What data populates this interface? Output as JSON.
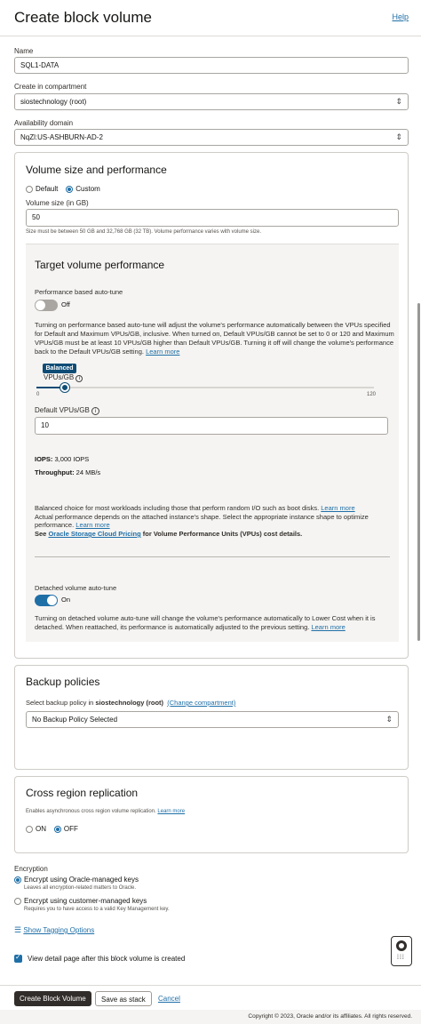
{
  "header": {
    "title": "Create block volume",
    "help": "Help"
  },
  "form": {
    "name_label": "Name",
    "name_value": "SQL1-DATA",
    "compartment_label": "Create in compartment",
    "compartment_value": "siostechnology (root)",
    "ad_label": "Availability domain",
    "ad_value": "NqZl:US-ASHBURN-AD-2"
  },
  "volume": {
    "title": "Volume size and performance",
    "default_label": "Default",
    "custom_label": "Custom",
    "size_label": "Volume size (in GB)",
    "size_value": "50",
    "size_help": "Size must be between 50 GB and 32,768 GB (32 TB). Volume performance varies with volume size."
  },
  "target": {
    "title": "Target volume performance",
    "autotune_label": "Performance based auto-tune",
    "autotune_state": "Off",
    "autotune_desc": "Turning on performance based auto-tune will adjust the volume's performance automatically between the VPUs specified for Default and Maximum VPUs/GB, inclusive. When turned on, Default VPUs/GB cannot be set to 0 or 120 and Maximum VPUs/GB must be at least 10 VPUs/GB higher than Default VPUs/GB. Turning it off will change the volume's performance back to the Default VPUs/GB setting.",
    "learn_more": "Learn more",
    "slider_tooltip": "Balanced",
    "slider_label": "VPUs/GB",
    "slider_min": "0",
    "slider_max": "120",
    "slider_value": 10,
    "default_vpus_label": "Default VPUs/GB",
    "default_vpus_value": "10",
    "iops_label": "IOPS:",
    "iops_value": "3,000 IOPS",
    "throughput_label": "Throughput:",
    "throughput_value": "24 MB/s",
    "balanced_desc": "Balanced choice for most workloads including those that perform random I/O such as boot disks.",
    "actual_perf": "Actual performance depends on the attached instance's shape. Select the appropriate instance shape to optimize performance.",
    "see_prefix": "See",
    "pricing_link": "Oracle Storage Cloud Pricing",
    "see_suffix": "for Volume Performance Units (VPUs) cost details.",
    "detached_label": "Detached volume auto-tune",
    "detached_state": "On",
    "detached_desc": "Turning on detached volume auto-tune will change the volume's performance automatically to Lower Cost when it is detached. When reattached, its performance is automatically adjusted to the previous setting."
  },
  "backup": {
    "title": "Backup policies",
    "select_prefix": "Select backup policy in",
    "compartment": "siostechnology (root)",
    "change_link": "(Change compartment)",
    "policy_value": "No Backup Policy Selected"
  },
  "replication": {
    "title": "Cross region replication",
    "desc": "Enables asynchronous cross region volume replication.",
    "learn_more": "Learn more",
    "on_label": "ON",
    "off_label": "OFF"
  },
  "encryption": {
    "label": "Encryption",
    "oracle_label": "Encrypt using Oracle-managed keys",
    "oracle_desc": "Leaves all encryption-related matters to Oracle.",
    "customer_label": "Encrypt using customer-managed keys",
    "customer_desc": "Requires you to have access to a valid Key Management key."
  },
  "tagging": {
    "link": "Show Tagging Options"
  },
  "view_detail": {
    "label": "View detail page after this block volume is created"
  },
  "footer": {
    "create": "Create Block Volume",
    "save_stack": "Save as stack",
    "cancel": "Cancel",
    "copyright": "Copyright © 2023, Oracle and/or its affiliates. All rights reserved."
  },
  "colors": {
    "accent": "#1f6fa7",
    "primary_button": "#312d2a",
    "slider_tooltip": "#0f4c75"
  }
}
